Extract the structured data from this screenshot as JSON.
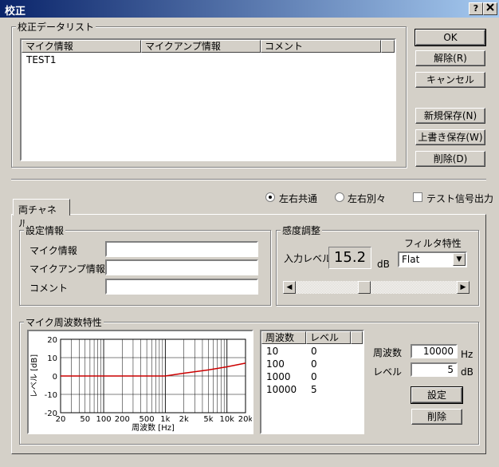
{
  "window": {
    "title": "校正",
    "help_label": "?",
    "close_label": "X"
  },
  "calib_list": {
    "group_label": "校正データリスト",
    "columns": [
      "マイク情報",
      "マイクアンプ情報",
      "コメント"
    ],
    "rows": [
      [
        "TEST1",
        "",
        ""
      ]
    ]
  },
  "buttons": {
    "ok": "OK",
    "release": "解除(R)",
    "cancel": "キャンセル",
    "save_new": "新規保存(N)",
    "overwrite": "上書き保存(W)",
    "delete": "削除(D)"
  },
  "channel_mode": {
    "options": [
      {
        "label": "左右共通",
        "selected": true
      },
      {
        "label": "左右別々",
        "selected": false
      }
    ],
    "test_signal_label": "テスト信号出力",
    "test_signal_checked": false
  },
  "tab": {
    "label": "両チャネル"
  },
  "settings_info": {
    "group_label": "設定情報",
    "mic_label": "マイク情報",
    "mic_value": "",
    "amp_label": "マイクアンプ情報",
    "amp_value": "",
    "comment_label": "コメント",
    "comment_value": ""
  },
  "sensitivity": {
    "group_label": "感度調整",
    "input_label": "入力レベル",
    "input_value": "15.2",
    "input_unit": "dB",
    "filter_label": "フィルタ特性",
    "filter_value": "Flat",
    "slider_value_fraction": 0.42
  },
  "freq_response": {
    "group_label": "マイク周波数特性",
    "table_headers": [
      "周波数",
      "レベル"
    ],
    "table_rows": [
      [
        "10",
        "0"
      ],
      [
        "100",
        "0"
      ],
      [
        "1000",
        "0"
      ],
      [
        "10000",
        "5"
      ]
    ],
    "freq_label": "周波数",
    "freq_value": "10000",
    "freq_unit": "Hz",
    "level_label": "レベル",
    "level_value": "5",
    "level_unit": "dB",
    "set_button": "設定",
    "delete_button": "削除"
  },
  "chart_data": {
    "type": "line",
    "xlabel": "周波数 [Hz]",
    "ylabel": "レベル [dB]",
    "x_scale": "log",
    "xlim": [
      20,
      20000
    ],
    "ylim": [
      -20,
      20
    ],
    "x_ticks": [
      "20",
      "50",
      "100",
      "200",
      "500",
      "1k",
      "2k",
      "5k",
      "10k",
      "20k"
    ],
    "y_ticks": [
      "20",
      "10",
      "0",
      "-10",
      "-20"
    ],
    "grid": true,
    "series": [
      {
        "color": "#cc0000",
        "x": [
          20,
          100,
          1000,
          2000,
          5000,
          10000,
          20000
        ],
        "y": [
          0,
          0,
          0,
          1.5,
          3.3,
          5,
          7
        ]
      }
    ]
  }
}
